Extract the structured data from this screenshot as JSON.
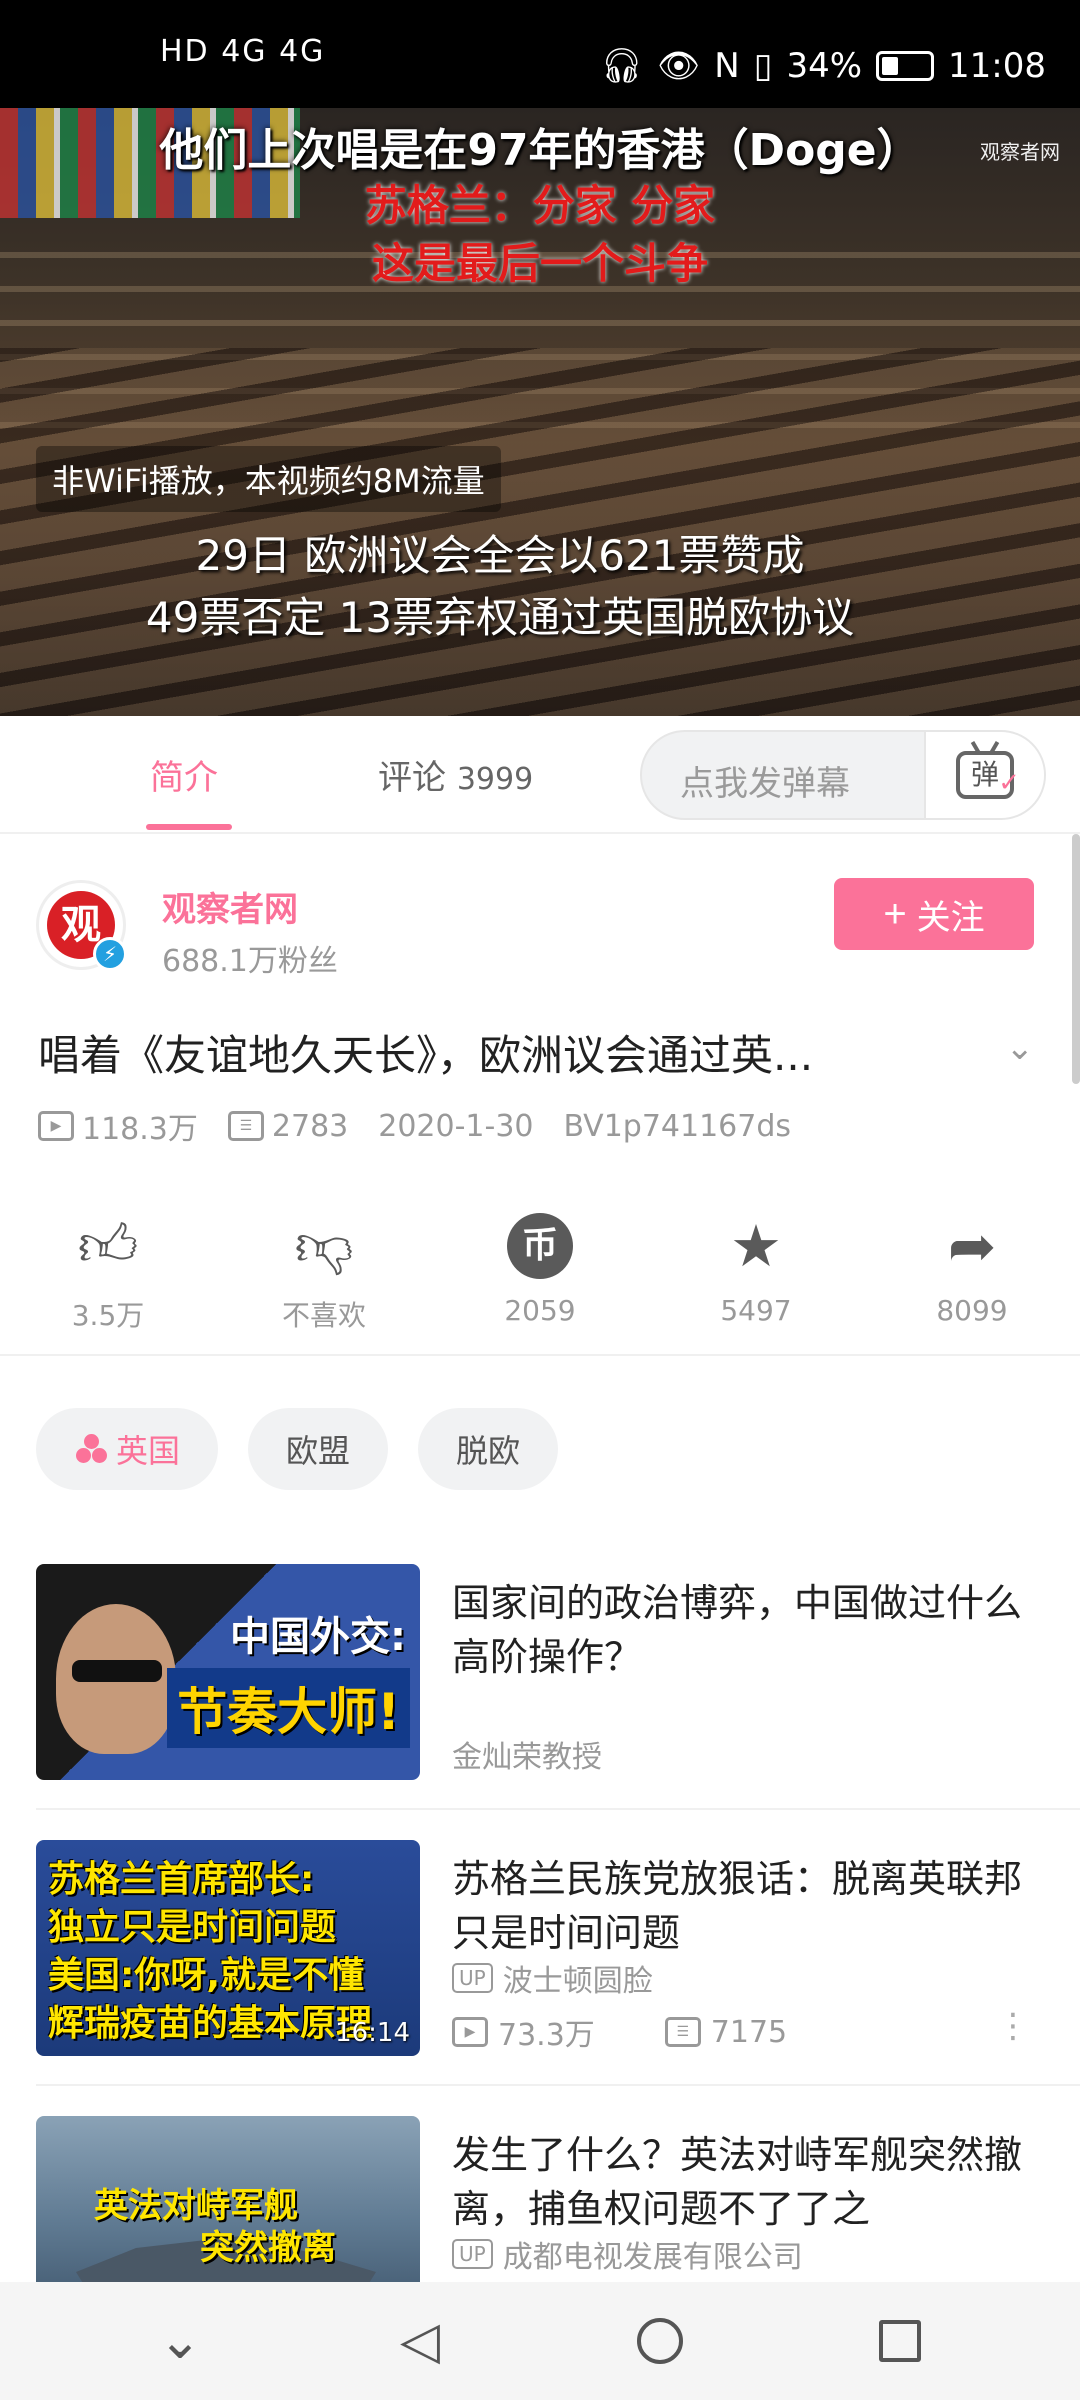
{
  "status_bar": {
    "left_icons": "HD 4G 4G",
    "battery": "34%",
    "battery_level": 0.34,
    "time": "11:08"
  },
  "video": {
    "caption_top": "他们上次唱是在97年的香港（Doge）",
    "caption_red_1": "苏格兰：分家 分家",
    "caption_red_2": "这是最后一个斗争",
    "watermark": "观察者网",
    "notice": "非WiFi播放，本视频约8M流量",
    "subtitle_1": "29日 欧洲议会全会以621票赞成",
    "subtitle_2": "49票否定 13票弃权通过英国脱欧协议"
  },
  "tabs": {
    "intro": "简介",
    "comments": "评论",
    "comments_count": "3999",
    "danmaku_placeholder": "点我发弹幕",
    "danmaku_btn": "弹"
  },
  "uploader": {
    "avatar_glyph": "观",
    "name": "观察者网",
    "fans": "688.1万粉丝",
    "follow": "关注"
  },
  "video_info": {
    "title": "唱着《友谊地久天长》，欧洲议会通过英...",
    "views": "118.3万",
    "danmaku": "2783",
    "date": "2020-1-30",
    "bvid": "BV1p741167ds"
  },
  "actions": [
    {
      "name": "like",
      "label": "3.5万"
    },
    {
      "name": "dislike",
      "label": "不喜欢"
    },
    {
      "name": "coin",
      "label": "2059"
    },
    {
      "name": "favorite",
      "label": "5497"
    },
    {
      "name": "share",
      "label": "8099"
    }
  ],
  "tags": [
    "英国",
    "欧盟",
    "脱欧"
  ],
  "recommended": [
    {
      "title": "国家间的政治博弈，中国做过什么高阶操作？",
      "author": "金灿荣教授",
      "thumb_caption_1": "中国外交:",
      "thumb_caption_2": "节奏大师!"
    },
    {
      "title": "苏格兰民族党放狠话：脱离英联邦只是时间问题",
      "author": "波士顿圆脸",
      "views": "73.3万",
      "danmaku": "7175",
      "duration": "16:14",
      "thumb_lines": [
        "苏格兰首席部长:",
        "独立只是时间问题",
        "美国:你呀,就是不懂",
        "辉瑞疫苗的基本原理"
      ]
    },
    {
      "title": "发生了什么？英法对峙军舰突然撤离，捕鱼权问题不了了之",
      "author": "成都电视发展有限公司",
      "thumb_caption_1": "英法对峙军舰",
      "thumb_caption_2": "突然撤离"
    }
  ]
}
